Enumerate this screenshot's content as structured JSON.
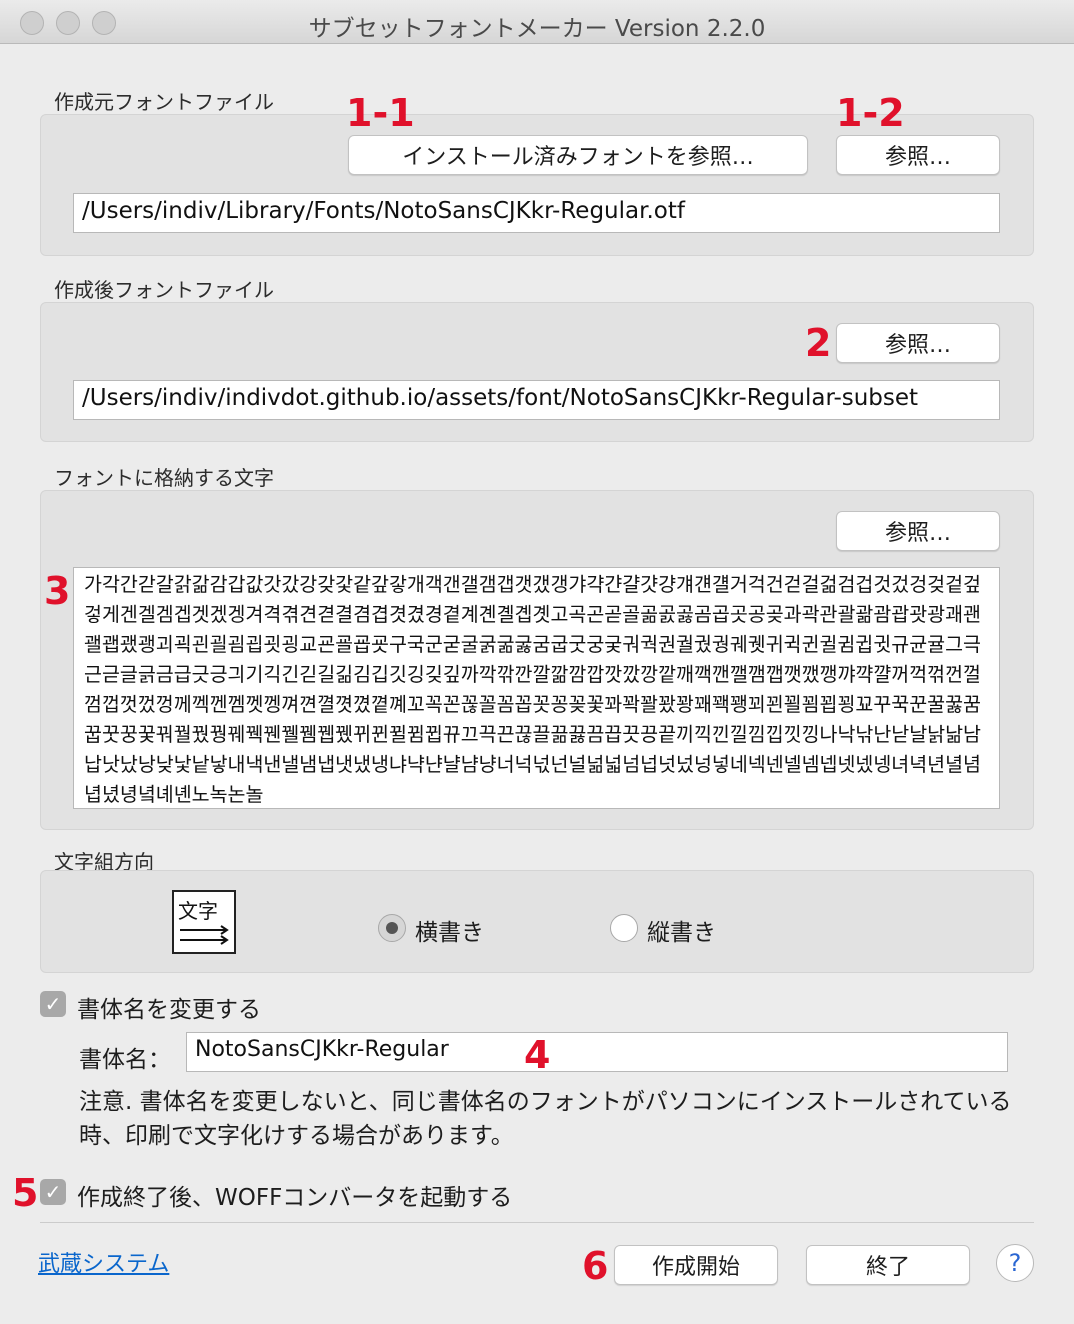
{
  "window": {
    "title": "サブセットフォントメーカー Version 2.2.0"
  },
  "source": {
    "label": "作成元フォントファイル",
    "installed_button": "インストール済みフォントを参照…",
    "browse_button": "参照…",
    "path": "/Users/indiv/Library/Fonts/NotoSansCJKkr-Regular.otf"
  },
  "output": {
    "label": "作成後フォントファイル",
    "browse_button": "参照…",
    "path": "/Users/indiv/indivdot.github.io/assets/font/NotoSansCJKkr-Regular-subset"
  },
  "chars": {
    "label": "フォントに格納する文字",
    "browse_button": "参照…",
    "text": "가각간갇갈갉갊감갑값갓갔강갖갗같갚갛개객갠갤갬갭갯갰갱갸갹갼걀걋걍걔걘걜거걱건걷걸걺검겁것겄겅겆겉겊겋게겐겔겜겝겟겠겡겨격겪견겯결겸겹겻겼경곁계곈곌곕곗고곡곤곧골곪곬곯곰곱곳공곶과곽관괄괆괌괍괏광괘괜괠괩괬괭괴괵괸괼굄굅굇굉교굔굘굡굣구국군굳굴굵굶굻굼굽굿궁궂궈궉권궐궜궝궤궷귀귁귄귈귐귑귓규균귤그극근귿글긁금급긋긍긔기긱긴긷길긺김깁깃깅깆깊까깍깎깐깔깖깜깝깟깠깡깥깨깩깬깰깸깹깻깼깽꺄꺅꺌꺼꺽꺾껀껄껌껍껏껐껑께껙껜껨껫껭껴껸껼꼇꼈꼍꼐꼬꼭꼰꼲꼴꼼꼽꼿꽁꽂꽃꽈꽉꽐꽜꽝꽤꽥꽹꾀꾄꾈꾐꾑꾕꾜꾸꾹꾼꿀꿇꿈꿉꿋꿍꿎꿔꿜꿨꿩꿰꿱꿴꿸뀀뀁뀄뀌뀐뀔뀜뀝뀨끄끅끈끊끌끎끓끔끕끗끙끝끼끽낀낄낌낍낏낑나낙낚난낟날낡낢남납낫났낭낮낯낱낳내낵낸낼냄냅냇냈냉냐냑냔냘냠냥너넉넋넌널넒넓넘넙넛넜넝넣네넥넨넬넴넵넷넸넹녀녁년녈념녑녔녕녘녜녠노녹논놀"
  },
  "direction": {
    "label": "文字組方向",
    "icon_text": "文字",
    "horizontal": "横書き",
    "vertical": "縦書き",
    "selected": "horizontal"
  },
  "rename": {
    "checkbox_label": "書体名を変更する",
    "checked": true,
    "name_label": "書体名：",
    "name_value": "NotoSansCJKkr-Regular",
    "note": "注意. 書体名を変更しないと、同じ書体名のフォントがパソコンにインストールされている時、印刷で文字化けする場合があります。"
  },
  "woff": {
    "checkbox_label": "作成終了後、WOFFコンバータを起動する",
    "checked": true
  },
  "footer": {
    "link": "武蔵システム",
    "start_button": "作成開始",
    "quit_button": "終了",
    "help": "?"
  },
  "annotations": {
    "a1": "1-1",
    "a2": "1-2",
    "a3": "2",
    "a4": "3",
    "a5": "4",
    "a6": "5",
    "a7": "6"
  },
  "colors": {
    "annotation": "#e0112b",
    "link": "#0a66cc",
    "background": "#ececec",
    "group_box": "#e2e2e2"
  }
}
